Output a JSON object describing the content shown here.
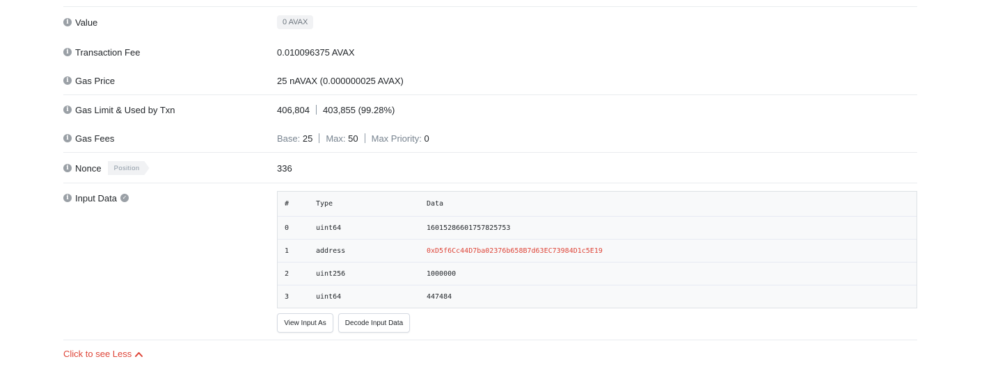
{
  "rows": {
    "value": {
      "label": "Value",
      "badge": "0 AVAX"
    },
    "fee": {
      "label": "Transaction Fee",
      "value": "0.010096375 AVAX"
    },
    "gas_price": {
      "label": "Gas Price",
      "value": "25 nAVAX (0.000000025 AVAX)"
    },
    "gas_limit": {
      "label": "Gas Limit & Used by Txn",
      "limit": "406,804",
      "used": "403,855 (99.28%)"
    },
    "gas_fees": {
      "label": "Gas Fees",
      "base_label": "Base:",
      "base": "25",
      "max_label": "Max:",
      "max": "50",
      "priority_label": "Max Priority:",
      "priority": "0"
    },
    "nonce": {
      "label": "Nonce",
      "tag": "Position",
      "value": "336"
    },
    "input": {
      "label": "Input Data"
    }
  },
  "input_table": {
    "headers": [
      "#",
      "Type",
      "Data"
    ],
    "rows": [
      {
        "index": "0",
        "type": "uint64",
        "data": "16015286601757825753"
      },
      {
        "index": "1",
        "type": "address",
        "data": "0xD5f6Cc44D7ba02376b658B7d63EC73984D1c5E19"
      },
      {
        "index": "2",
        "type": "uint256",
        "data": "1000000"
      },
      {
        "index": "3",
        "type": "uint64",
        "data": "447484"
      }
    ]
  },
  "buttons": {
    "view_as": "View Input As",
    "decode": "Decode Input Data"
  },
  "toggle": {
    "label": "Click to see Less"
  },
  "icons": {
    "info": "info-icon",
    "check": "check-circle-icon",
    "chevron": "chevron-up-icon"
  },
  "colors": {
    "accent_red": "#de4437",
    "muted": "#77838f",
    "border": "#e9ecef"
  }
}
